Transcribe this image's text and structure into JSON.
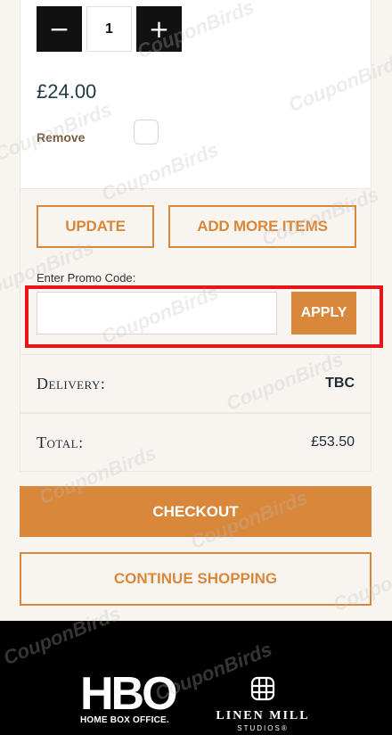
{
  "cart_item": {
    "minus_symbol": "−",
    "plus_symbol": "+",
    "quantity": "1",
    "price": "£24.00",
    "remove_label": "Remove"
  },
  "actions": {
    "update_label": "UPDATE",
    "add_more_label": "ADD MORE ITEMS",
    "promo_label": "Enter Promo Code:",
    "promo_value": "",
    "apply_label": "APPLY"
  },
  "summary": {
    "delivery_label": "Delivery:",
    "delivery_value": "TBC",
    "total_label": "Total:",
    "total_value": "£53.50"
  },
  "buttons": {
    "checkout_label": "CHECKOUT",
    "continue_label": "CONTINUE SHOPPING"
  },
  "footer": {
    "hbo_word": "HBO",
    "hbo_tagline": "HOME BOX OFFICE.",
    "linen_word": "LINEN MILL",
    "linen_sub": "STUDIOS®"
  },
  "watermark": "CouponBirds",
  "colors": {
    "accent": "#d9873a",
    "highlight": "#e8141c",
    "dark": "#111111",
    "background": "#f8f5f1"
  }
}
